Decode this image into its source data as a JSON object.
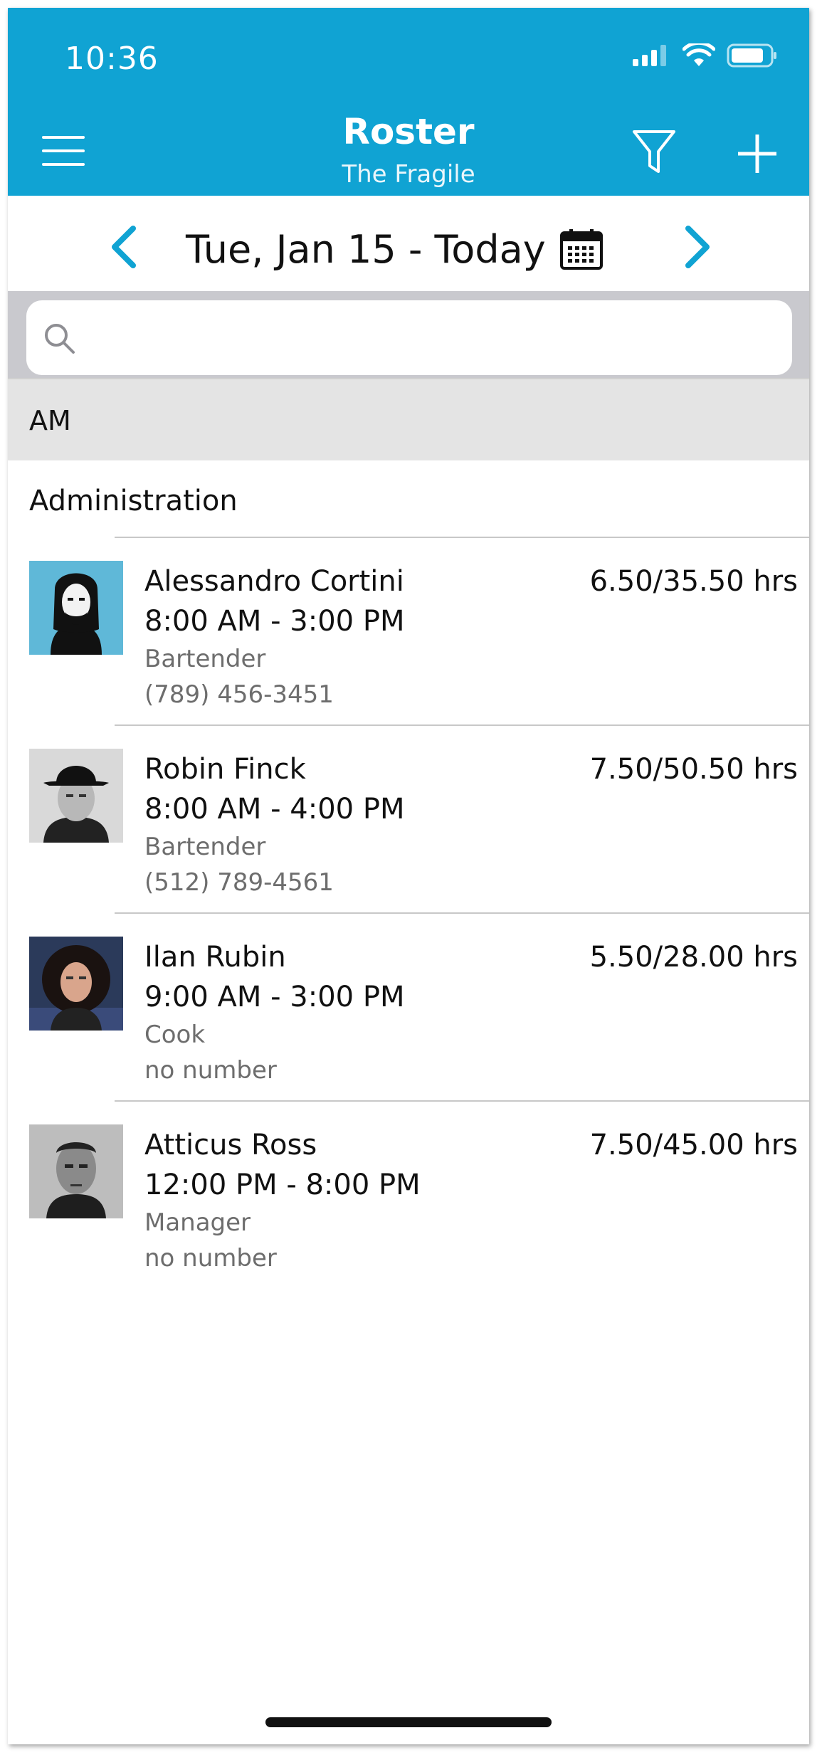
{
  "status_bar": {
    "time": "10:36"
  },
  "nav": {
    "title": "Roster",
    "subtitle": "The Fragile"
  },
  "date_bar": {
    "label": "Tue, Jan 15 - Today"
  },
  "search": {
    "placeholder": ""
  },
  "section": {
    "label": "AM"
  },
  "group": {
    "label": "Administration"
  },
  "roster": [
    {
      "name": "Alessandro Cortini",
      "time": "8:00 AM - 3:00 PM",
      "role": "Bartender",
      "phone": "(789) 456-3451",
      "hours": "6.50/35.50 hrs"
    },
    {
      "name": "Robin Finck",
      "time": "8:00 AM - 4:00 PM",
      "role": "Bartender",
      "phone": "(512) 789-4561",
      "hours": "7.50/50.50 hrs"
    },
    {
      "name": "Ilan Rubin",
      "time": "9:00 AM - 3:00 PM",
      "role": "Cook",
      "phone": "no number",
      "hours": "5.50/28.00 hrs"
    },
    {
      "name": "Atticus Ross",
      "time": "12:00 PM - 8:00 PM",
      "role": "Manager",
      "phone": "no number",
      "hours": "7.50/45.00 hrs"
    }
  ],
  "icons": {
    "menu": "hamburger-icon",
    "filter": "filter-icon",
    "add": "plus-icon",
    "prev": "chevron-left-icon",
    "next": "chevron-right-icon",
    "calendar": "calendar-icon",
    "search": "search-icon"
  },
  "colors": {
    "accent": "#10a3d3",
    "section_bg": "#e4e4e4",
    "search_bg": "#c9c9ce"
  }
}
